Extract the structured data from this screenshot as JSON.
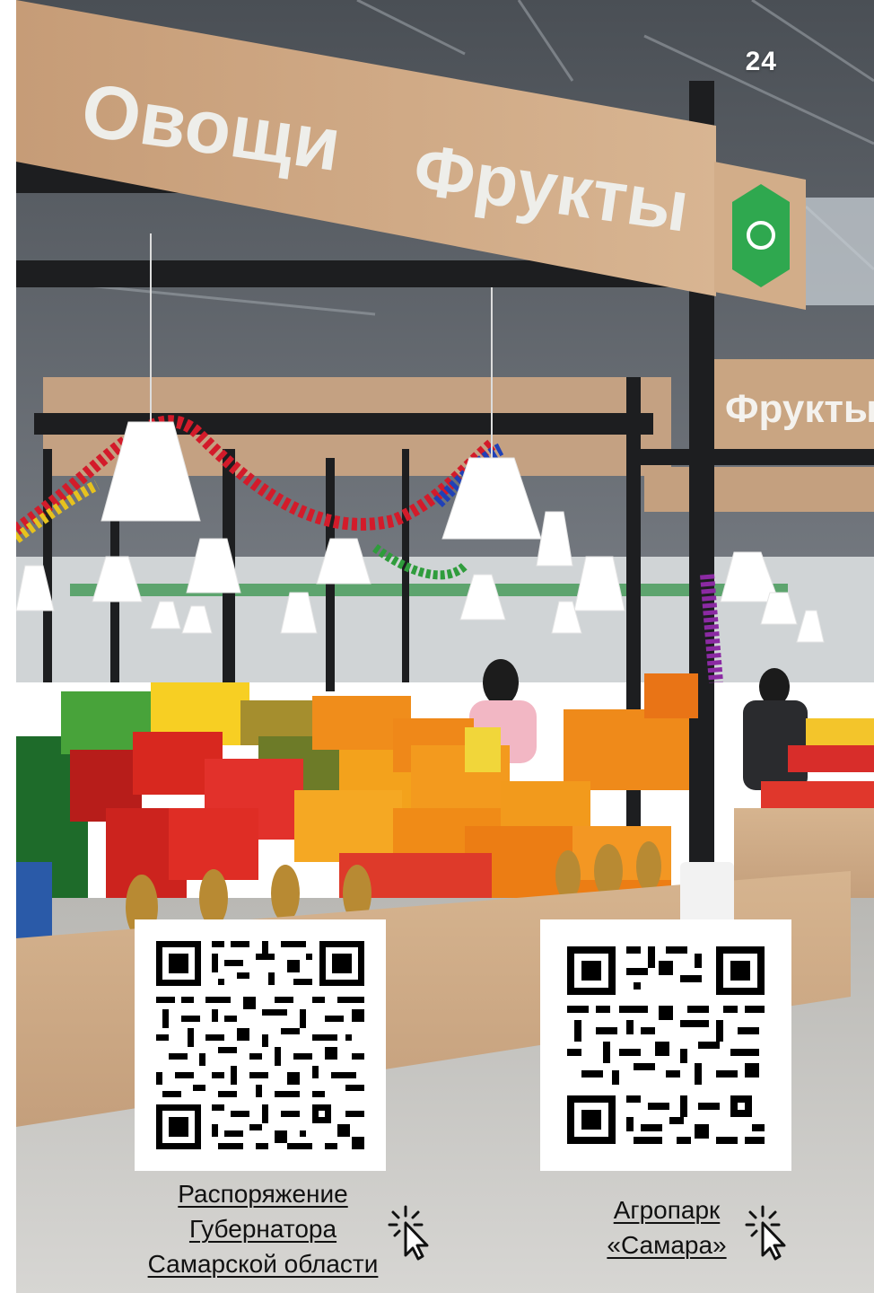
{
  "page_number": "24",
  "photo": {
    "sign_main_1": "Овощи",
    "sign_main_2": "Фрукты",
    "sign_back": "Фрукты"
  },
  "qr_codes": [
    {
      "icon": "qr-code-icon"
    },
    {
      "icon": "qr-code-icon"
    }
  ],
  "links": {
    "governor_order": {
      "line1": "Распоряжение",
      "line2": "Губернатора",
      "line3": "Самарской области"
    },
    "agropark": {
      "line1": "Агропарк",
      "line2": "«Самара»"
    }
  },
  "icons": {
    "click": "cursor-click-icon"
  },
  "colors": {
    "sign_wood": "#c9a27e",
    "logo_green": "#2fa84f",
    "link_text": "#111111"
  }
}
